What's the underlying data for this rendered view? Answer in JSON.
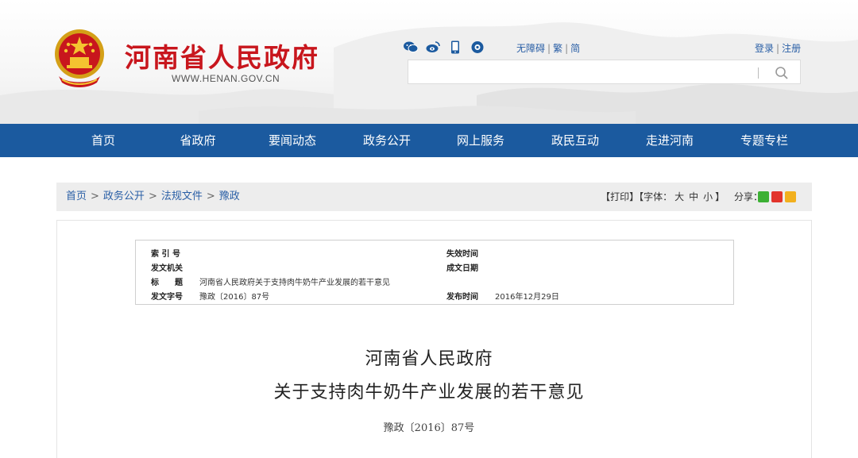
{
  "header": {
    "site_title": "河南省人民政府",
    "site_url": "WWW.HENAN.GOV.CN",
    "social_icons": [
      "wechat-icon",
      "weibo-icon",
      "mobile-icon",
      "podcast-icon"
    ],
    "accessibility": {
      "barrier_free": "无障碍",
      "traditional": "繁",
      "simplified": "简"
    },
    "account": {
      "login": "登录",
      "register": "注册"
    },
    "search": {
      "placeholder": ""
    }
  },
  "nav": {
    "items": [
      {
        "label": "首页"
      },
      {
        "label": "省政府"
      },
      {
        "label": "要闻动态"
      },
      {
        "label": "政务公开"
      },
      {
        "label": "网上服务"
      },
      {
        "label": "政民互动"
      },
      {
        "label": "走进河南"
      },
      {
        "label": "专题专栏"
      }
    ]
  },
  "breadcrumb": [
    "首页",
    "政务公开",
    "法规文件",
    "豫政"
  ],
  "tools": {
    "print": "【打印】",
    "font_prefix": "【字体：",
    "font_large": "大",
    "font_medium": "中",
    "font_small": "小",
    "font_suffix": "】",
    "share_label": "分享："
  },
  "meta": {
    "index_label": "索 引 号",
    "index_value": "",
    "issuer_label": "发文机关",
    "issuer_value": "",
    "title_label": "标　　题",
    "title_value": "河南省人民政府关于支持肉牛奶牛产业发展的若干意见",
    "docno_label": "发文字号",
    "docno_value": "豫政〔2016〕87号",
    "expire_label": "失效时间",
    "expire_value": "",
    "written_label": "成文日期",
    "written_value": "",
    "publish_label": "发布时间",
    "publish_value": "2016年12月29日"
  },
  "document": {
    "title_line1": "河南省人民政府",
    "title_line2": "关于支持肉牛奶牛产业发展的若干意见",
    "number": "豫政〔2016〕87号"
  },
  "colors": {
    "brand_red": "#c8161d",
    "nav_blue": "#1b5a9f",
    "link_blue": "#2a5fa6"
  }
}
